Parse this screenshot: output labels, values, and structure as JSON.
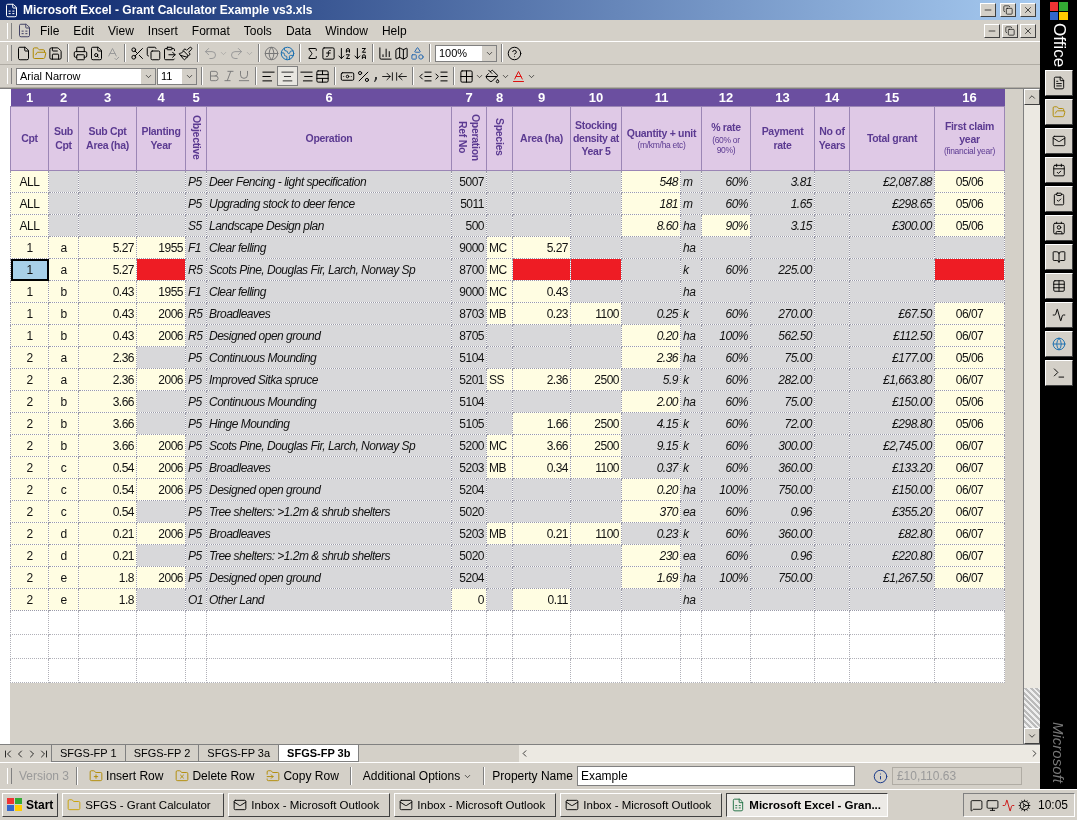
{
  "window": {
    "title": "Microsoft Excel - Grant Calculator Example vs3.xls"
  },
  "menu": [
    "File",
    "Edit",
    "View",
    "Insert",
    "Format",
    "Tools",
    "Data",
    "Window",
    "Help"
  ],
  "standard_toolbar": {
    "zoom": "100%"
  },
  "formatting_toolbar": {
    "font": "Arial Narrow",
    "size": "11"
  },
  "sheet": {
    "column_numbers": [
      "1",
      "2",
      "3",
      "4",
      "5",
      "6",
      "7",
      "8",
      "9",
      "10",
      "11",
      "12",
      "13",
      "14",
      "15",
      "16"
    ],
    "columns": [
      {
        "label": "Cpt",
        "kind": "flat"
      },
      {
        "label": "Sub Cpt",
        "kind": "flat"
      },
      {
        "label": "Sub Cpt Area (ha)",
        "kind": "flat"
      },
      {
        "label": "Planting Year",
        "kind": "flat"
      },
      {
        "label": "Objective",
        "kind": "vertical"
      },
      {
        "label": "Operation",
        "kind": "flat"
      },
      {
        "label": "Operation Ref No",
        "kind": "vertical"
      },
      {
        "label": "Species",
        "kind": "vertical"
      },
      {
        "label": "Area (ha)",
        "kind": "flat"
      },
      {
        "label": "Stocking density at Year 5",
        "kind": "flat"
      },
      {
        "label": "Quantity + unit",
        "note": "(m/km/ha etc)",
        "kind": "flat",
        "colspan": 2
      },
      {
        "label": "% rate",
        "note": "(60% or 90%)",
        "kind": "flat"
      },
      {
        "label": "Payment rate",
        "kind": "flat"
      },
      {
        "label": "No of Years",
        "kind": "flat"
      },
      {
        "label": "Total grant",
        "kind": "flat"
      },
      {
        "label": "First claim year",
        "note": "(financial year)",
        "kind": "flat"
      }
    ],
    "rows": [
      {
        "cells": [
          {
            "text": "ALL",
            "kind": "input"
          },
          {
            "kind": "calc"
          },
          {
            "kind": "calc"
          },
          {
            "kind": "calc"
          },
          {
            "text": "P5",
            "kind": "calc"
          },
          {
            "text": "Deer Fencing - light specification",
            "kind": "calc"
          },
          {
            "text": "5007",
            "kind": "calc"
          },
          {
            "kind": "calc"
          },
          {
            "kind": "calc"
          },
          {
            "kind": "calc"
          },
          {
            "text": "548",
            "kind": "input"
          },
          {
            "text": "m",
            "kind": "calc"
          },
          {
            "text": "60%",
            "kind": "calc"
          },
          {
            "text": "3.81",
            "kind": "calc"
          },
          {
            "kind": "calc"
          },
          {
            "text": "£2,087.88",
            "kind": "calc"
          },
          {
            "text": "05/06",
            "kind": "input"
          }
        ]
      },
      {
        "cells": [
          {
            "text": "ALL",
            "kind": "input"
          },
          {
            "kind": "calc"
          },
          {
            "kind": "calc"
          },
          {
            "kind": "calc"
          },
          {
            "text": "P5",
            "kind": "calc"
          },
          {
            "text": "Upgrading stock to deer fence",
            "kind": "calc"
          },
          {
            "text": "5011",
            "kind": "calc"
          },
          {
            "kind": "calc"
          },
          {
            "kind": "calc"
          },
          {
            "kind": "calc"
          },
          {
            "text": "181",
            "kind": "input"
          },
          {
            "text": "m",
            "kind": "calc"
          },
          {
            "text": "60%",
            "kind": "calc"
          },
          {
            "text": "1.65",
            "kind": "calc"
          },
          {
            "kind": "calc"
          },
          {
            "text": "£298.65",
            "kind": "calc"
          },
          {
            "text": "05/06",
            "kind": "input"
          }
        ]
      },
      {
        "cells": [
          {
            "text": "ALL",
            "kind": "input"
          },
          {
            "kind": "calc"
          },
          {
            "kind": "calc"
          },
          {
            "kind": "calc"
          },
          {
            "text": "S5",
            "kind": "calc"
          },
          {
            "text": "Landscape Design plan",
            "kind": "calc"
          },
          {
            "text": "500",
            "kind": "calc"
          },
          {
            "kind": "calc"
          },
          {
            "kind": "calc"
          },
          {
            "kind": "calc"
          },
          {
            "text": "8.60",
            "kind": "input"
          },
          {
            "text": "ha",
            "kind": "calc"
          },
          {
            "text": "90%",
            "kind": "input"
          },
          {
            "text": "3.15",
            "kind": "calc"
          },
          {
            "kind": "calc"
          },
          {
            "text": "£300.00",
            "kind": "calc"
          },
          {
            "text": "05/06",
            "kind": "input"
          }
        ]
      },
      {
        "cells": [
          {
            "text": "1",
            "kind": "input"
          },
          {
            "text": "a",
            "kind": "input"
          },
          {
            "text": "5.27",
            "kind": "input"
          },
          {
            "text": "1955",
            "kind": "input"
          },
          {
            "text": "F1",
            "kind": "calc"
          },
          {
            "text": "Clear felling",
            "kind": "calc"
          },
          {
            "text": "9000",
            "kind": "calc"
          },
          {
            "text": "MC",
            "kind": "input"
          },
          {
            "text": "5.27",
            "kind": "input"
          },
          {
            "kind": "calc"
          },
          {
            "kind": "calc"
          },
          {
            "text": "ha",
            "kind": "calc"
          },
          {
            "kind": "calc"
          },
          {
            "kind": "calc"
          },
          {
            "kind": "calc"
          },
          {
            "kind": "calc"
          },
          {
            "kind": "calc"
          }
        ]
      },
      {
        "cells": [
          {
            "text": "1",
            "kind": "selected"
          },
          {
            "text": "a",
            "kind": "input"
          },
          {
            "text": "5.27",
            "kind": "input"
          },
          {
            "kind": "error"
          },
          {
            "text": "R5",
            "kind": "calc"
          },
          {
            "text": "Scots Pine, Douglas Fir, Larch, Norway Sp",
            "kind": "calc"
          },
          {
            "text": "8700",
            "kind": "calc"
          },
          {
            "text": "MC",
            "kind": "input"
          },
          {
            "kind": "error"
          },
          {
            "kind": "error"
          },
          {
            "kind": "calc"
          },
          {
            "text": "k",
            "kind": "calc"
          },
          {
            "text": "60%",
            "kind": "calc"
          },
          {
            "text": "225.00",
            "kind": "calc"
          },
          {
            "kind": "calc"
          },
          {
            "kind": "calc"
          },
          {
            "kind": "error"
          }
        ]
      },
      {
        "cells": [
          {
            "text": "1",
            "kind": "input"
          },
          {
            "text": "b",
            "kind": "input"
          },
          {
            "text": "0.43",
            "kind": "input"
          },
          {
            "text": "1955",
            "kind": "input"
          },
          {
            "text": "F1",
            "kind": "calc"
          },
          {
            "text": "Clear felling",
            "kind": "calc"
          },
          {
            "text": "9000",
            "kind": "calc"
          },
          {
            "text": "MC",
            "kind": "input"
          },
          {
            "text": "0.43",
            "kind": "input"
          },
          {
            "kind": "calc"
          },
          {
            "kind": "calc"
          },
          {
            "text": "ha",
            "kind": "calc"
          },
          {
            "kind": "calc"
          },
          {
            "kind": "calc"
          },
          {
            "kind": "calc"
          },
          {
            "kind": "calc"
          },
          {
            "kind": "calc"
          }
        ]
      },
      {
        "cells": [
          {
            "text": "1",
            "kind": "input"
          },
          {
            "text": "b",
            "kind": "input"
          },
          {
            "text": "0.43",
            "kind": "input"
          },
          {
            "text": "2006",
            "kind": "input"
          },
          {
            "text": "R5",
            "kind": "calc"
          },
          {
            "text": "Broadleaves",
            "kind": "calc"
          },
          {
            "text": "8703",
            "kind": "calc"
          },
          {
            "text": "MB",
            "kind": "input"
          },
          {
            "text": "0.23",
            "kind": "input"
          },
          {
            "text": "1100",
            "kind": "input"
          },
          {
            "text": "0.25",
            "kind": "calc"
          },
          {
            "text": "k",
            "kind": "calc"
          },
          {
            "text": "60%",
            "kind": "calc"
          },
          {
            "text": "270.00",
            "kind": "calc"
          },
          {
            "kind": "calc"
          },
          {
            "text": "£67.50",
            "kind": "calc"
          },
          {
            "text": "06/07",
            "kind": "input"
          }
        ]
      },
      {
        "cells": [
          {
            "text": "1",
            "kind": "input"
          },
          {
            "text": "b",
            "kind": "input"
          },
          {
            "text": "0.43",
            "kind": "input"
          },
          {
            "text": "2006",
            "kind": "input"
          },
          {
            "text": "R5",
            "kind": "calc"
          },
          {
            "text": "Designed open ground",
            "kind": "calc"
          },
          {
            "text": "8705",
            "kind": "calc"
          },
          {
            "kind": "calc"
          },
          {
            "kind": "calc"
          },
          {
            "kind": "calc"
          },
          {
            "text": "0.20",
            "kind": "input"
          },
          {
            "text": "ha",
            "kind": "calc"
          },
          {
            "text": "100%",
            "kind": "calc"
          },
          {
            "text": "562.50",
            "kind": "calc"
          },
          {
            "kind": "calc"
          },
          {
            "text": "£112.50",
            "kind": "calc"
          },
          {
            "text": "06/07",
            "kind": "input"
          }
        ]
      },
      {
        "cells": [
          {
            "text": "2",
            "kind": "input"
          },
          {
            "text": "a",
            "kind": "input"
          },
          {
            "text": "2.36",
            "kind": "input"
          },
          {
            "kind": "calc"
          },
          {
            "text": "P5",
            "kind": "calc"
          },
          {
            "text": "Continuous Mounding",
            "kind": "calc"
          },
          {
            "text": "5104",
            "kind": "calc"
          },
          {
            "kind": "calc"
          },
          {
            "kind": "calc"
          },
          {
            "kind": "calc"
          },
          {
            "text": "2.36",
            "kind": "input"
          },
          {
            "text": "ha",
            "kind": "calc"
          },
          {
            "text": "60%",
            "kind": "calc"
          },
          {
            "text": "75.00",
            "kind": "calc"
          },
          {
            "kind": "calc"
          },
          {
            "text": "£177.00",
            "kind": "calc"
          },
          {
            "text": "05/06",
            "kind": "input"
          }
        ]
      },
      {
        "cells": [
          {
            "text": "2",
            "kind": "input"
          },
          {
            "text": "a",
            "kind": "input"
          },
          {
            "text": "2.36",
            "kind": "input"
          },
          {
            "text": "2006",
            "kind": "input"
          },
          {
            "text": "P5",
            "kind": "calc"
          },
          {
            "text": "Improved Sitka spruce",
            "kind": "calc"
          },
          {
            "text": "5201",
            "kind": "calc"
          },
          {
            "text": "SS",
            "kind": "input"
          },
          {
            "text": "2.36",
            "kind": "input"
          },
          {
            "text": "2500",
            "kind": "input"
          },
          {
            "text": "5.9",
            "kind": "calc"
          },
          {
            "text": "k",
            "kind": "calc"
          },
          {
            "text": "60%",
            "kind": "calc"
          },
          {
            "text": "282.00",
            "kind": "calc"
          },
          {
            "kind": "calc"
          },
          {
            "text": "£1,663.80",
            "kind": "calc"
          },
          {
            "text": "06/07",
            "kind": "input"
          }
        ]
      },
      {
        "cells": [
          {
            "text": "2",
            "kind": "input"
          },
          {
            "text": "b",
            "kind": "input"
          },
          {
            "text": "3.66",
            "kind": "input"
          },
          {
            "kind": "calc"
          },
          {
            "text": "P5",
            "kind": "calc"
          },
          {
            "text": "Continuous Mounding",
            "kind": "calc"
          },
          {
            "text": "5104",
            "kind": "calc"
          },
          {
            "kind": "calc"
          },
          {
            "kind": "calc"
          },
          {
            "kind": "calc"
          },
          {
            "text": "2.00",
            "kind": "input"
          },
          {
            "text": "ha",
            "kind": "calc"
          },
          {
            "text": "60%",
            "kind": "calc"
          },
          {
            "text": "75.00",
            "kind": "calc"
          },
          {
            "kind": "calc"
          },
          {
            "text": "£150.00",
            "kind": "calc"
          },
          {
            "text": "05/06",
            "kind": "input"
          }
        ]
      },
      {
        "cells": [
          {
            "text": "2",
            "kind": "input"
          },
          {
            "text": "b",
            "kind": "input"
          },
          {
            "text": "3.66",
            "kind": "input"
          },
          {
            "kind": "calc"
          },
          {
            "text": "P5",
            "kind": "calc"
          },
          {
            "text": "Hinge Mounding",
            "kind": "calc"
          },
          {
            "text": "5105",
            "kind": "calc"
          },
          {
            "kind": "calc"
          },
          {
            "text": "1.66",
            "kind": "input"
          },
          {
            "text": "2500",
            "kind": "input"
          },
          {
            "text": "4.15",
            "kind": "calc"
          },
          {
            "text": "k",
            "kind": "calc"
          },
          {
            "text": "60%",
            "kind": "calc"
          },
          {
            "text": "72.00",
            "kind": "calc"
          },
          {
            "kind": "calc"
          },
          {
            "text": "£298.80",
            "kind": "calc"
          },
          {
            "text": "05/06",
            "kind": "input"
          }
        ]
      },
      {
        "cells": [
          {
            "text": "2",
            "kind": "input"
          },
          {
            "text": "b",
            "kind": "input"
          },
          {
            "text": "3.66",
            "kind": "input"
          },
          {
            "text": "2006",
            "kind": "input"
          },
          {
            "text": "P5",
            "kind": "calc"
          },
          {
            "text": "Scots Pine, Douglas Fir, Larch, Norway Sp",
            "kind": "calc"
          },
          {
            "text": "5200",
            "kind": "calc"
          },
          {
            "text": "MC",
            "kind": "input"
          },
          {
            "text": "3.66",
            "kind": "input"
          },
          {
            "text": "2500",
            "kind": "input"
          },
          {
            "text": "9.15",
            "kind": "calc"
          },
          {
            "text": "k",
            "kind": "calc"
          },
          {
            "text": "60%",
            "kind": "calc"
          },
          {
            "text": "300.00",
            "kind": "calc"
          },
          {
            "kind": "calc"
          },
          {
            "text": "£2,745.00",
            "kind": "calc"
          },
          {
            "text": "06/07",
            "kind": "input"
          }
        ]
      },
      {
        "cells": [
          {
            "text": "2",
            "kind": "input"
          },
          {
            "text": "c",
            "kind": "input"
          },
          {
            "text": "0.54",
            "kind": "input"
          },
          {
            "text": "2006",
            "kind": "input"
          },
          {
            "text": "P5",
            "kind": "calc"
          },
          {
            "text": "Broadleaves",
            "kind": "calc"
          },
          {
            "text": "5203",
            "kind": "calc"
          },
          {
            "text": "MB",
            "kind": "input"
          },
          {
            "text": "0.34",
            "kind": "input"
          },
          {
            "text": "1100",
            "kind": "input"
          },
          {
            "text": "0.37",
            "kind": "calc"
          },
          {
            "text": "k",
            "kind": "calc"
          },
          {
            "text": "60%",
            "kind": "calc"
          },
          {
            "text": "360.00",
            "kind": "calc"
          },
          {
            "kind": "calc"
          },
          {
            "text": "£133.20",
            "kind": "calc"
          },
          {
            "text": "06/07",
            "kind": "input"
          }
        ]
      },
      {
        "cells": [
          {
            "text": "2",
            "kind": "input"
          },
          {
            "text": "c",
            "kind": "input"
          },
          {
            "text": "0.54",
            "kind": "input"
          },
          {
            "text": "2006",
            "kind": "input"
          },
          {
            "text": "P5",
            "kind": "calc"
          },
          {
            "text": "Designed open ground",
            "kind": "calc"
          },
          {
            "text": "5204",
            "kind": "calc"
          },
          {
            "kind": "calc"
          },
          {
            "kind": "calc"
          },
          {
            "kind": "calc"
          },
          {
            "text": "0.20",
            "kind": "input"
          },
          {
            "text": "ha",
            "kind": "calc"
          },
          {
            "text": "100%",
            "kind": "calc"
          },
          {
            "text": "750.00",
            "kind": "calc"
          },
          {
            "kind": "calc"
          },
          {
            "text": "£150.00",
            "kind": "calc"
          },
          {
            "text": "06/07",
            "kind": "input"
          }
        ]
      },
      {
        "cells": [
          {
            "text": "2",
            "kind": "input"
          },
          {
            "text": "c",
            "kind": "input"
          },
          {
            "text": "0.54",
            "kind": "input"
          },
          {
            "kind": "calc"
          },
          {
            "text": "P5",
            "kind": "calc"
          },
          {
            "text": "Tree shelters: >1.2m & shrub shelters",
            "kind": "calc"
          },
          {
            "text": "5020",
            "kind": "calc"
          },
          {
            "kind": "calc"
          },
          {
            "kind": "calc"
          },
          {
            "kind": "calc"
          },
          {
            "text": "370",
            "kind": "input"
          },
          {
            "text": "ea",
            "kind": "calc"
          },
          {
            "text": "60%",
            "kind": "calc"
          },
          {
            "text": "0.96",
            "kind": "calc"
          },
          {
            "kind": "calc"
          },
          {
            "text": "£355.20",
            "kind": "calc"
          },
          {
            "text": "06/07",
            "kind": "input"
          }
        ]
      },
      {
        "cells": [
          {
            "text": "2",
            "kind": "input"
          },
          {
            "text": "d",
            "kind": "input"
          },
          {
            "text": "0.21",
            "kind": "input"
          },
          {
            "text": "2006",
            "kind": "input"
          },
          {
            "text": "P5",
            "kind": "calc"
          },
          {
            "text": "Broadleaves",
            "kind": "calc"
          },
          {
            "text": "5203",
            "kind": "calc"
          },
          {
            "text": "MB",
            "kind": "input"
          },
          {
            "text": "0.21",
            "kind": "input"
          },
          {
            "text": "1100",
            "kind": "input"
          },
          {
            "text": "0.23",
            "kind": "calc"
          },
          {
            "text": "k",
            "kind": "calc"
          },
          {
            "text": "60%",
            "kind": "calc"
          },
          {
            "text": "360.00",
            "kind": "calc"
          },
          {
            "kind": "calc"
          },
          {
            "text": "£82.80",
            "kind": "calc"
          },
          {
            "text": "06/07",
            "kind": "input"
          }
        ]
      },
      {
        "cells": [
          {
            "text": "2",
            "kind": "input"
          },
          {
            "text": "d",
            "kind": "input"
          },
          {
            "text": "0.21",
            "kind": "input"
          },
          {
            "kind": "calc"
          },
          {
            "text": "P5",
            "kind": "calc"
          },
          {
            "text": "Tree shelters: >1.2m & shrub shelters",
            "kind": "calc"
          },
          {
            "text": "5020",
            "kind": "calc"
          },
          {
            "kind": "calc"
          },
          {
            "kind": "calc"
          },
          {
            "kind": "calc"
          },
          {
            "text": "230",
            "kind": "input"
          },
          {
            "text": "ea",
            "kind": "calc"
          },
          {
            "text": "60%",
            "kind": "calc"
          },
          {
            "text": "0.96",
            "kind": "calc"
          },
          {
            "kind": "calc"
          },
          {
            "text": "£220.80",
            "kind": "calc"
          },
          {
            "text": "06/07",
            "kind": "input"
          }
        ]
      },
      {
        "cells": [
          {
            "text": "2",
            "kind": "input"
          },
          {
            "text": "e",
            "kind": "input"
          },
          {
            "text": "1.8",
            "kind": "input"
          },
          {
            "text": "2006",
            "kind": "input"
          },
          {
            "text": "P5",
            "kind": "calc"
          },
          {
            "text": "Designed open ground",
            "kind": "calc"
          },
          {
            "text": "5204",
            "kind": "calc"
          },
          {
            "kind": "calc"
          },
          {
            "kind": "calc"
          },
          {
            "kind": "calc"
          },
          {
            "text": "1.69",
            "kind": "input"
          },
          {
            "text": "ha",
            "kind": "calc"
          },
          {
            "text": "100%",
            "kind": "calc"
          },
          {
            "text": "750.00",
            "kind": "calc"
          },
          {
            "kind": "calc"
          },
          {
            "text": "£1,267.50",
            "kind": "calc"
          },
          {
            "text": "06/07",
            "kind": "input"
          }
        ]
      },
      {
        "cells": [
          {
            "text": "2",
            "kind": "input"
          },
          {
            "text": "e",
            "kind": "input"
          },
          {
            "text": "1.8",
            "kind": "input"
          },
          {
            "kind": "calc"
          },
          {
            "text": "O1",
            "kind": "calc"
          },
          {
            "text": "Other Land",
            "kind": "calc"
          },
          {
            "text": "0",
            "kind": "input"
          },
          {
            "kind": "calc"
          },
          {
            "text": "0.11",
            "kind": "input"
          },
          {
            "kind": "calc"
          },
          {
            "kind": "calc"
          },
          {
            "text": "ha",
            "kind": "calc"
          },
          {
            "kind": "calc"
          },
          {
            "kind": "calc"
          },
          {
            "kind": "calc"
          },
          {
            "kind": "calc"
          },
          {
            "kind": "calc"
          }
        ]
      }
    ]
  },
  "sheet_tabs": [
    {
      "label": "SFGS-FP 1",
      "selected": false
    },
    {
      "label": "SFGS-FP 2",
      "selected": false
    },
    {
      "label": "SFGS-FP 3a",
      "selected": false
    },
    {
      "label": "SFGS-FP 3b",
      "selected": true
    }
  ],
  "custom_toolbar": {
    "version": "Version 3",
    "buttons": [
      "Insert Row",
      "Delete Row",
      "Copy Row"
    ],
    "options": "Additional Options",
    "property_label": "Property Name",
    "property_value": "Example",
    "total": "£10,110.63"
  },
  "office_bar": {
    "top": "Office",
    "bottom": "Microsoft"
  },
  "taskbar": {
    "start": "Start",
    "tasks": [
      {
        "label": "SFGS - Grant Calculator",
        "kind": "folder",
        "selected": false
      },
      {
        "label": "Inbox - Microsoft Outlook",
        "kind": "mail",
        "selected": false
      },
      {
        "label": "Inbox - Microsoft Outlook",
        "kind": "mail",
        "selected": false
      },
      {
        "label": "Inbox - Microsoft Outlook",
        "kind": "mail",
        "selected": false
      },
      {
        "label": "Microsoft Excel - Gran...",
        "kind": "excel",
        "selected": true
      }
    ],
    "clock": "10:05"
  }
}
